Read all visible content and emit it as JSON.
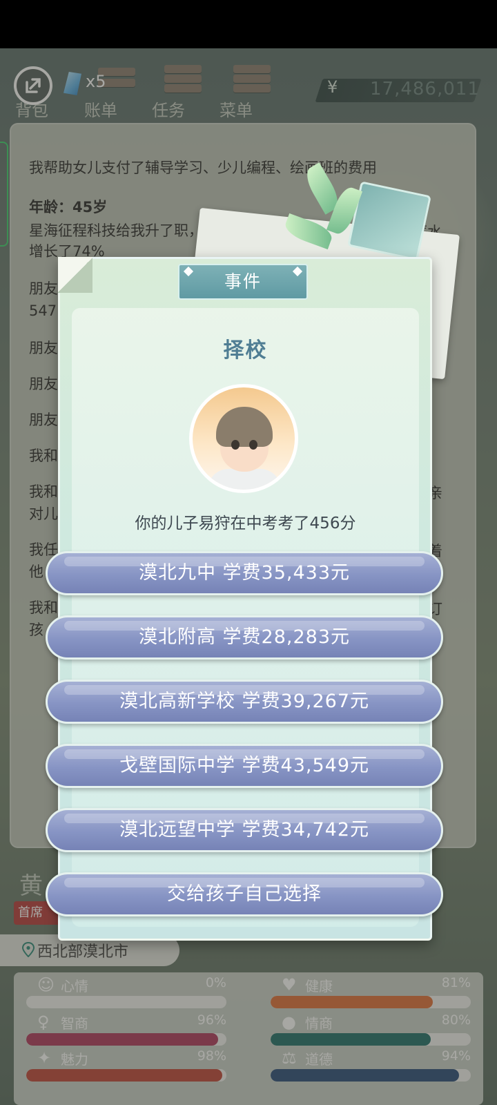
{
  "topbar": {
    "gem_count": "x5",
    "currency_symbol": "¥",
    "money": "17,486,011",
    "tabs": [
      "背包",
      "账单",
      "任务",
      "菜单"
    ]
  },
  "log": {
    "lines": [
      "我帮助女儿支付了辅导学习、少儿编程、绘画班的费用",
      "年龄：45岁",
      "星海征程科技给我升了职，任命我为首席大",
      "增长了74%",
      "朋友",
      "547",
      "朋友",
      "朋友",
      "朋友",
      "我和",
      "我和",
      "对儿",
      "我任",
      "他",
      "我和",
      "孩"
    ],
    "right_fragments": [
      "薪水",
      "亲",
      "着",
      "订"
    ]
  },
  "character": {
    "name_fragment": "黄",
    "title_fragment": "首席",
    "location": "西北部漠北市"
  },
  "stats": [
    {
      "label": "心情",
      "value": "0%",
      "fraction": 0.0,
      "color": "#c8c8c8",
      "icon": "smile-icon"
    },
    {
      "label": "健康",
      "value": "81%",
      "fraction": 0.81,
      "color": "#e0703a",
      "icon": "heart-icon"
    },
    {
      "label": "智商",
      "value": "96%",
      "fraction": 0.96,
      "color": "#b03a5e",
      "icon": "bulb-icon"
    },
    {
      "label": "情商",
      "value": "80%",
      "fraction": 0.8,
      "color": "#1f6f6a",
      "icon": "apple-icon"
    },
    {
      "label": "魅力",
      "value": "98%",
      "fraction": 0.98,
      "color": "#c0463a",
      "icon": "sparkle-icon"
    },
    {
      "label": "道德",
      "value": "94%",
      "fraction": 0.94,
      "color": "#2a4e7a",
      "icon": "scale-icon"
    }
  ],
  "modal": {
    "banner": "事件",
    "title": "择校",
    "description": "你的儿子易狩在中考考了456分",
    "choices": [
      "漠北九中  学费35,433元",
      "漠北附高  学费28,283元",
      "漠北高新学校  学费39,267元",
      "戈壁国际中学  学费43,549元",
      "漠北远望中学  学费34,742元",
      "交给孩子自己选择"
    ]
  }
}
